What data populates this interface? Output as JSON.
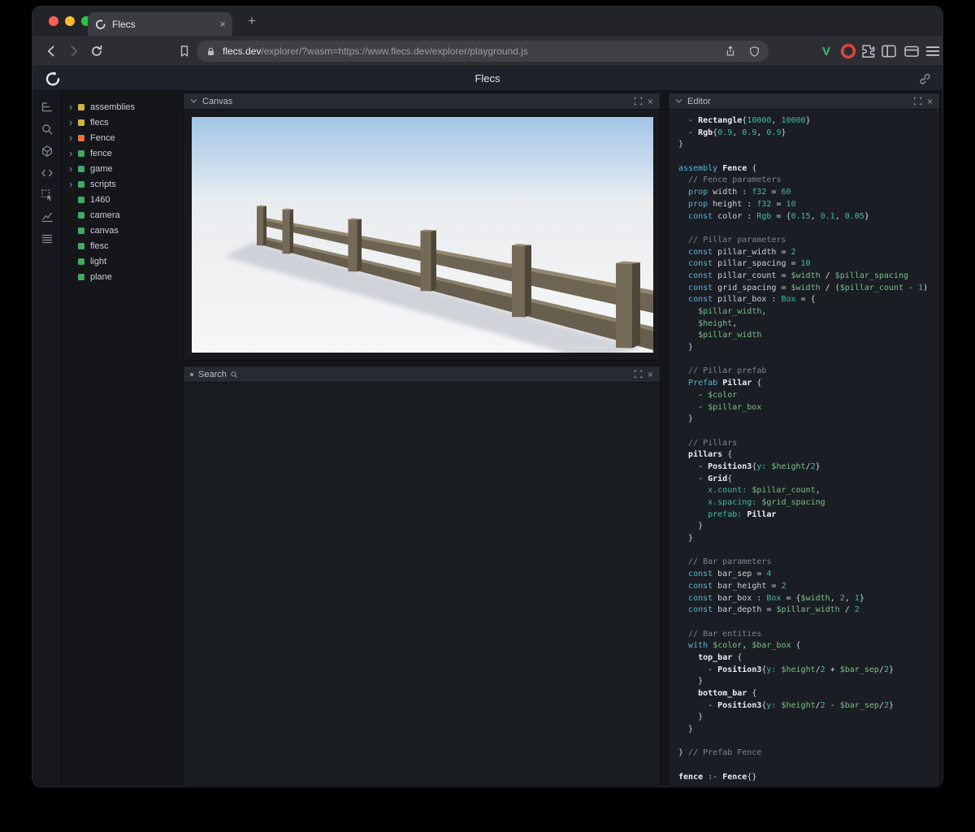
{
  "browser": {
    "tab": {
      "title": "Flecs",
      "close_glyph": "×"
    },
    "new_tab_glyph": "+",
    "address": {
      "host": "flecs.dev",
      "path": "/explorer/?wasm=https://www.flecs.dev/explorer/playground.js"
    },
    "extension_v_glyph": "V"
  },
  "app": {
    "title": "Flecs"
  },
  "sidebar_icons": [
    "tree",
    "search",
    "cube",
    "code",
    "inspect",
    "chart",
    "rows"
  ],
  "tree": {
    "items": [
      {
        "label": "assemblies",
        "expandable": true,
        "color": "tree-yellow"
      },
      {
        "label": "flecs",
        "expandable": true,
        "color": "tree-yellow"
      },
      {
        "label": "Fence",
        "expandable": true,
        "color": "tree-orange"
      },
      {
        "label": "fence",
        "expandable": true,
        "color": "tree-green"
      },
      {
        "label": "game",
        "expandable": true,
        "color": "tree-green"
      },
      {
        "label": "scripts",
        "expandable": true,
        "color": "tree-green"
      },
      {
        "label": "1460",
        "expandable": false,
        "color": "tree-green"
      },
      {
        "label": "camera",
        "expandable": false,
        "color": "tree-green"
      },
      {
        "label": "canvas",
        "expandable": false,
        "color": "tree-green"
      },
      {
        "label": "flesc",
        "expandable": false,
        "color": "tree-green"
      },
      {
        "label": "light",
        "expandable": false,
        "color": "tree-green"
      },
      {
        "label": "plane",
        "expandable": false,
        "color": "tree-green"
      }
    ]
  },
  "panels": {
    "canvas": {
      "title": "Canvas",
      "close_glyph": "×"
    },
    "search": {
      "title": "Search",
      "close_glyph": "×"
    },
    "editor": {
      "title": "Editor",
      "close_glyph": "×"
    }
  },
  "editor": {
    "lines": [
      [
        [
          "t",
          "  - "
        ],
        [
          "e",
          "Rectangle"
        ],
        [
          "t",
          "{"
        ],
        [
          "n",
          "10000"
        ],
        [
          "t",
          ", "
        ],
        [
          "n",
          "10000"
        ],
        [
          "t",
          "}"
        ]
      ],
      [
        [
          "t",
          "  - "
        ],
        [
          "e",
          "Rgb"
        ],
        [
          "t",
          "{"
        ],
        [
          "n",
          "0.9"
        ],
        [
          "t",
          ", "
        ],
        [
          "n",
          "0.9"
        ],
        [
          "t",
          ", "
        ],
        [
          "n",
          "0.9"
        ],
        [
          "t",
          "}"
        ]
      ],
      [
        [
          "t",
          "}"
        ]
      ],
      [],
      [
        [
          "k",
          "assembly"
        ],
        [
          "t",
          " "
        ],
        [
          "e",
          "Fence"
        ],
        [
          "t",
          " {"
        ]
      ],
      [
        [
          "c",
          "  // Fence parameters"
        ]
      ],
      [
        [
          "t",
          "  "
        ],
        [
          "k",
          "prop"
        ],
        [
          "t",
          " width : "
        ],
        [
          "y",
          "f32"
        ],
        [
          "t",
          " = "
        ],
        [
          "n",
          "60"
        ]
      ],
      [
        [
          "t",
          "  "
        ],
        [
          "k",
          "prop"
        ],
        [
          "t",
          " height : "
        ],
        [
          "y",
          "f32"
        ],
        [
          "t",
          " = "
        ],
        [
          "n",
          "10"
        ]
      ],
      [
        [
          "t",
          "  "
        ],
        [
          "k",
          "const"
        ],
        [
          "t",
          " color : "
        ],
        [
          "y",
          "Rgb"
        ],
        [
          "t",
          " = {"
        ],
        [
          "n",
          "0.15"
        ],
        [
          "t",
          ", "
        ],
        [
          "n",
          "0.1"
        ],
        [
          "t",
          ", "
        ],
        [
          "n",
          "0.05"
        ],
        [
          "t",
          "}"
        ]
      ],
      [],
      [
        [
          "c",
          "  // Pillar parameters"
        ]
      ],
      [
        [
          "t",
          "  "
        ],
        [
          "k",
          "const"
        ],
        [
          "t",
          " pillar_width = "
        ],
        [
          "n",
          "2"
        ]
      ],
      [
        [
          "t",
          "  "
        ],
        [
          "k",
          "const"
        ],
        [
          "t",
          " pillar_spacing = "
        ],
        [
          "n",
          "10"
        ]
      ],
      [
        [
          "t",
          "  "
        ],
        [
          "k",
          "const"
        ],
        [
          "t",
          " pillar_count = "
        ],
        [
          "v",
          "$width"
        ],
        [
          "t",
          " / "
        ],
        [
          "v",
          "$pillar_spacing"
        ]
      ],
      [
        [
          "t",
          "  "
        ],
        [
          "k",
          "const"
        ],
        [
          "t",
          " grid_spacing = "
        ],
        [
          "v",
          "$width"
        ],
        [
          "t",
          " / ("
        ],
        [
          "v",
          "$pillar_count"
        ],
        [
          "t",
          " - "
        ],
        [
          "n",
          "1"
        ],
        [
          "t",
          ")"
        ]
      ],
      [
        [
          "t",
          "  "
        ],
        [
          "k",
          "const"
        ],
        [
          "t",
          " pillar_box : "
        ],
        [
          "y",
          "Box"
        ],
        [
          "t",
          " = {"
        ]
      ],
      [
        [
          "t",
          "    "
        ],
        [
          "v",
          "$pillar_width"
        ],
        [
          "t",
          ","
        ]
      ],
      [
        [
          "t",
          "    "
        ],
        [
          "v",
          "$height"
        ],
        [
          "t",
          ","
        ]
      ],
      [
        [
          "t",
          "    "
        ],
        [
          "v",
          "$pillar_width"
        ]
      ],
      [
        [
          "t",
          "  }"
        ]
      ],
      [],
      [
        [
          "c",
          "  // Pillar prefab"
        ]
      ],
      [
        [
          "t",
          "  "
        ],
        [
          "k",
          "Prefab"
        ],
        [
          "t",
          " "
        ],
        [
          "e",
          "Pillar"
        ],
        [
          "t",
          " {"
        ]
      ],
      [
        [
          "t",
          "    - "
        ],
        [
          "v",
          "$color"
        ]
      ],
      [
        [
          "t",
          "    - "
        ],
        [
          "v",
          "$pillar_box"
        ]
      ],
      [
        [
          "t",
          "  }"
        ]
      ],
      [],
      [
        [
          "c",
          "  // Pillars"
        ]
      ],
      [
        [
          "t",
          "  "
        ],
        [
          "e",
          "pillars"
        ],
        [
          "t",
          " {"
        ]
      ],
      [
        [
          "t",
          "    - "
        ],
        [
          "e",
          "Position3"
        ],
        [
          "t",
          "{"
        ],
        [
          "p",
          "y:"
        ],
        [
          "t",
          " "
        ],
        [
          "v",
          "$height"
        ],
        [
          "t",
          "/"
        ],
        [
          "n",
          "2"
        ],
        [
          "t",
          "}"
        ]
      ],
      [
        [
          "t",
          "    - "
        ],
        [
          "e",
          "Grid"
        ],
        [
          "t",
          "{"
        ]
      ],
      [
        [
          "t",
          "      "
        ],
        [
          "p",
          "x.count:"
        ],
        [
          "t",
          " "
        ],
        [
          "v",
          "$pillar_count"
        ],
        [
          "t",
          ","
        ]
      ],
      [
        [
          "t",
          "      "
        ],
        [
          "p",
          "x.spacing:"
        ],
        [
          "t",
          " "
        ],
        [
          "v",
          "$grid_spacing"
        ]
      ],
      [
        [
          "t",
          "      "
        ],
        [
          "p",
          "prefab:"
        ],
        [
          "t",
          " "
        ],
        [
          "e",
          "Pillar"
        ]
      ],
      [
        [
          "t",
          "    }"
        ]
      ],
      [
        [
          "t",
          "  }"
        ]
      ],
      [],
      [
        [
          "c",
          "  // Bar parameters"
        ]
      ],
      [
        [
          "t",
          "  "
        ],
        [
          "k",
          "const"
        ],
        [
          "t",
          " bar_sep = "
        ],
        [
          "n",
          "4"
        ]
      ],
      [
        [
          "t",
          "  "
        ],
        [
          "k",
          "const"
        ],
        [
          "t",
          " bar_height = "
        ],
        [
          "n",
          "2"
        ]
      ],
      [
        [
          "t",
          "  "
        ],
        [
          "k",
          "const"
        ],
        [
          "t",
          " bar_box : "
        ],
        [
          "y",
          "Box"
        ],
        [
          "t",
          " = {"
        ],
        [
          "v",
          "$width"
        ],
        [
          "t",
          ", "
        ],
        [
          "n",
          "2"
        ],
        [
          "t",
          ", "
        ],
        [
          "n",
          "1"
        ],
        [
          "t",
          "}"
        ]
      ],
      [
        [
          "t",
          "  "
        ],
        [
          "k",
          "const"
        ],
        [
          "t",
          " bar_depth = "
        ],
        [
          "v",
          "$pillar_width"
        ],
        [
          "t",
          " / "
        ],
        [
          "n",
          "2"
        ]
      ],
      [],
      [
        [
          "c",
          "  // Bar entities"
        ]
      ],
      [
        [
          "t",
          "  "
        ],
        [
          "k",
          "with"
        ],
        [
          "t",
          " "
        ],
        [
          "v",
          "$color"
        ],
        [
          "t",
          ", "
        ],
        [
          "v",
          "$bar_box"
        ],
        [
          "t",
          " {"
        ]
      ],
      [
        [
          "t",
          "    "
        ],
        [
          "e",
          "top_bar"
        ],
        [
          "t",
          " {"
        ]
      ],
      [
        [
          "t",
          "      - "
        ],
        [
          "e",
          "Position3"
        ],
        [
          "t",
          "{"
        ],
        [
          "p",
          "y:"
        ],
        [
          "t",
          " "
        ],
        [
          "v",
          "$height"
        ],
        [
          "t",
          "/"
        ],
        [
          "n",
          "2"
        ],
        [
          "t",
          " + "
        ],
        [
          "v",
          "$bar_sep"
        ],
        [
          "t",
          "/"
        ],
        [
          "n",
          "2"
        ],
        [
          "t",
          "}"
        ]
      ],
      [
        [
          "t",
          "    }"
        ]
      ],
      [
        [
          "t",
          "    "
        ],
        [
          "e",
          "bottom_bar"
        ],
        [
          "t",
          " {"
        ]
      ],
      [
        [
          "t",
          "      - "
        ],
        [
          "e",
          "Position3"
        ],
        [
          "t",
          "{"
        ],
        [
          "p",
          "y:"
        ],
        [
          "t",
          " "
        ],
        [
          "v",
          "$height"
        ],
        [
          "t",
          "/"
        ],
        [
          "n",
          "2"
        ],
        [
          "t",
          " - "
        ],
        [
          "v",
          "$bar_sep"
        ],
        [
          "t",
          "/"
        ],
        [
          "n",
          "2"
        ],
        [
          "t",
          "}"
        ]
      ],
      [
        [
          "t",
          "    }"
        ]
      ],
      [
        [
          "t",
          "  }"
        ]
      ],
      [],
      [
        [
          "t",
          "} "
        ],
        [
          "c",
          "// Prefab Fence"
        ]
      ],
      [],
      [
        [
          "e",
          "fence"
        ],
        [
          "t",
          " :- "
        ],
        [
          "e",
          "Fence"
        ],
        [
          "t",
          "{}"
        ]
      ]
    ]
  },
  "colors": {
    "light-red": "#ff5f57",
    "light-yellow": "#febc2e",
    "light-green": "#28c840",
    "v-badge": "#35c06e",
    "red-badge": "#d8453c",
    "tree-yellow": "#d4b13f",
    "tree-orange": "#e8743b",
    "tree-green": "#44a963",
    "code-kw": "#56b6d8",
    "code-type": "#3fbf9f",
    "code-var": "#76c287",
    "code-cmt": "#7d8694",
    "code-ent": "#e9ecf0",
    "code-txt": "#ced3da",
    "sky-top": "#a3c5e7",
    "sky-horizon": "#e9eef2",
    "ground-near": "#f6f7f8",
    "ground-far": "#e9ecee",
    "fence-front": "#6e6453",
    "fence-side": "#4e4639",
    "fence-cap": "#93876d",
    "fence-shadow": "#a7aeb9"
  }
}
